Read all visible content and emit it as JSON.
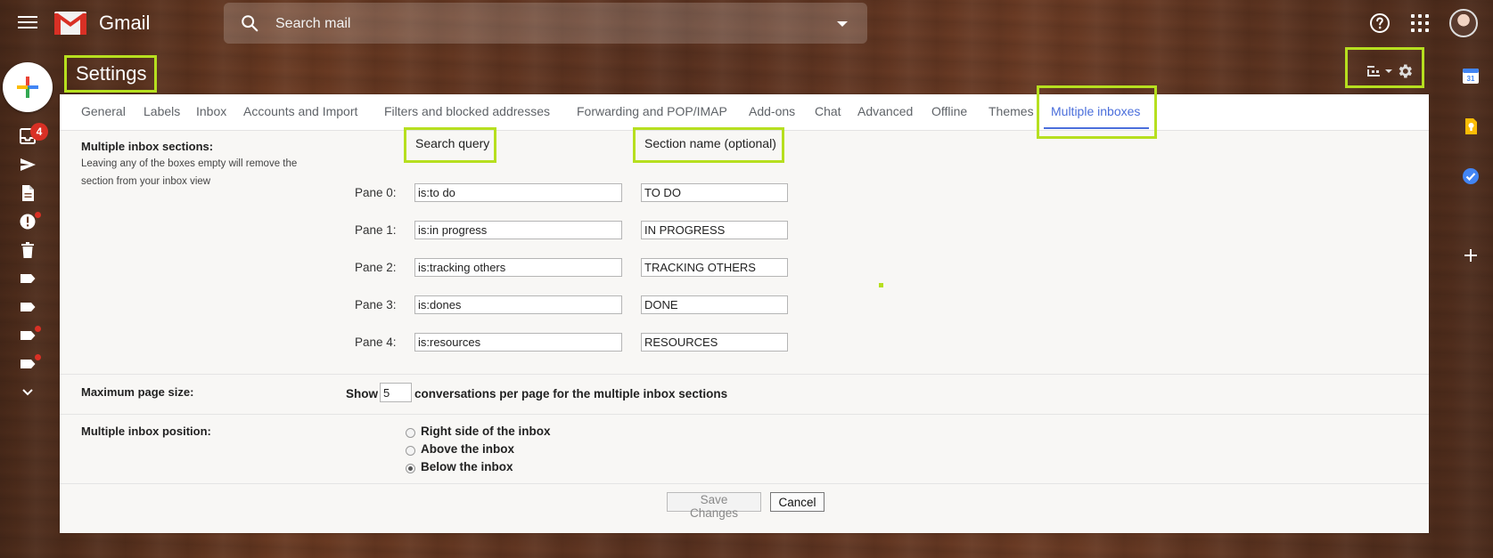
{
  "app": {
    "name": "Gmail"
  },
  "search": {
    "placeholder": "Search mail"
  },
  "rail": {
    "inbox_badge": "4"
  },
  "page": {
    "title": "Settings"
  },
  "tabs": [
    {
      "label": "General"
    },
    {
      "label": "Labels"
    },
    {
      "label": "Inbox"
    },
    {
      "label": "Accounts and Import"
    },
    {
      "label": "Filters and blocked addresses"
    },
    {
      "label": "Forwarding and POP/IMAP"
    },
    {
      "label": "Add-ons"
    },
    {
      "label": "Chat"
    },
    {
      "label": "Advanced"
    },
    {
      "label": "Offline"
    },
    {
      "label": "Themes"
    },
    {
      "label": "Multiple inboxes"
    }
  ],
  "sections": {
    "title": "Multiple inbox sections:",
    "help": "Leaving any of the boxes empty will remove the section from your inbox view",
    "search_query_header": "Search query",
    "section_name_header": "Section name (optional)",
    "panes": [
      {
        "label": "Pane 0:",
        "query": "is:to do",
        "name": "TO DO"
      },
      {
        "label": "Pane 1:",
        "query": "is:in progress",
        "name": "IN PROGRESS"
      },
      {
        "label": "Pane 2:",
        "query": "is:tracking others",
        "name": "TRACKING OTHERS"
      },
      {
        "label": "Pane 3:",
        "query": "is:dones",
        "name": "DONE"
      },
      {
        "label": "Pane 4:",
        "query": "is:resources",
        "name": "RESOURCES"
      }
    ]
  },
  "page_size": {
    "label": "Maximum page size:",
    "prefix": "Show",
    "value": "5",
    "suffix": "conversations per page for the multiple inbox sections"
  },
  "position": {
    "label": "Multiple inbox position:",
    "options": [
      {
        "label": "Right side of the inbox",
        "selected": false
      },
      {
        "label": "Above the inbox",
        "selected": false
      },
      {
        "label": "Below the inbox",
        "selected": true
      }
    ]
  },
  "actions": {
    "save": "Save Changes",
    "cancel": "Cancel"
  },
  "colors": {
    "highlight": "#b6df1f",
    "active_tab": "#4a6edb",
    "badge": "#d93025"
  }
}
